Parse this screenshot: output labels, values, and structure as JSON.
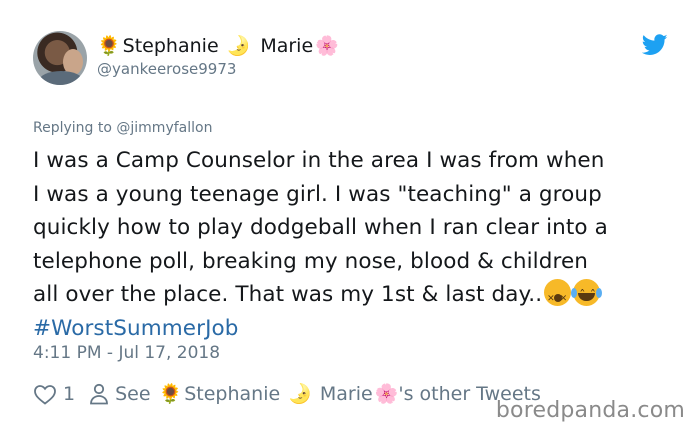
{
  "user": {
    "name_part1": "Stephanie",
    "name_part2": "Marie",
    "handle": "@yankeerose9973",
    "emoji_sunflower": "🌻",
    "emoji_moon": "🌛",
    "emoji_blossom": "🌸"
  },
  "reply": {
    "prefix": "Replying to",
    "handle": "@jimmyfallon"
  },
  "tweet": {
    "lines": [
      "I was a Camp Counselor in the area I was from when",
      "I was a young teenage girl. I was \"teaching\" a group",
      "quickly how to play dodgeball when I ran clear into a",
      "telephone poll, breaking my nose, blood & children",
      "all over the place. That was my 1st & last day.."
    ],
    "hashtag": "#WorstSummerJob",
    "timestamp": "4:11 PM - Jul 17, 2018"
  },
  "actions": {
    "like_count": "1",
    "see_prefix": "See",
    "see_suffix": "'s other Tweets"
  },
  "watermark": "boredpanda.com",
  "colors": {
    "text": "#14171a",
    "secondary": "#657786",
    "link": "#2a6aa6",
    "twitter_blue": "#1da1f2"
  },
  "icons": [
    "avatar",
    "sunflower-emoji",
    "moon-emoji",
    "blossom-emoji",
    "twitter-bird-icon",
    "dizzy-face-emoji",
    "tears-of-joy-emoji",
    "heart-icon",
    "person-icon"
  ]
}
